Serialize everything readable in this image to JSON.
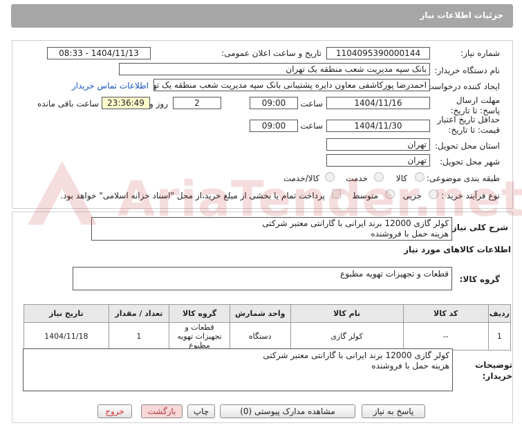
{
  "window": {
    "title": "جزئیات اطلاعات نیاز"
  },
  "form": {
    "need_number_label": "شماره نیاز:",
    "need_number": "1104095390000144",
    "announce_label": "تاریخ و ساعت اعلان عمومی:",
    "announce_value": "1404/11/13 - 08:33",
    "buyer_label": "نام دستگاه خریدار:",
    "buyer_value": "بانک سپه مدیریت شعب منطقه یک تهران",
    "requester_label": "ایجاد کننده درخواست:",
    "requester_value": "احمدرضا پورکاشفی معاون دایره پشتیبانی بانک سپه مدیریت شعب منطقه یک تهران",
    "contact_link": "اطلاعات تماس خریدار",
    "reply_deadline_label": "مهلت ارسال پاسخ: تا تاریخ:",
    "reply_date": "1404/11/16",
    "time_label": "ساعت",
    "reply_time": "09:00",
    "days_value": "2",
    "days_label": "روز و",
    "remaining_time": "23:36:49",
    "remaining_label": "ساعت باقی مانده",
    "validity_label": "حداقل تاریخ اعتبار قیمت: تا تاریخ:",
    "validity_date": "1404/11/30",
    "validity_time": "09:00",
    "province_label": "استان محل تحویل:",
    "province_value": "تهران",
    "city_label": "شهر محل تحویل:",
    "city_value": "تهران",
    "category_label": "طبقه بندی موضوعی:",
    "category_options": [
      "کالا",
      "خدمت",
      "کالا/خدمت"
    ],
    "process_label": "نوع فرآیند خرید :",
    "process_options": [
      "جزیی",
      "متوسط"
    ],
    "payment_note": "پرداخت تمام یا بخشی از مبلغ خرید،از محل \"اسناد خزانه اسلامی\" خواهد بود."
  },
  "description": {
    "label": "شرح کلی نیاز:",
    "line1": "کولر گازی 12000 برند ایرانی با گارانتی معتبر شرکتی",
    "line2": "هزینه حمل با فروشنده"
  },
  "goods": {
    "section_title": "اطلاعات کالاهای مورد نیاز",
    "group_label": "گروه کالا:",
    "group_value": "قطعات و تجهیزات تهویه مطبوع",
    "headers": [
      "ردیف",
      "کد کالا",
      "نام کالا",
      "واحد شمارش",
      "گروه کالا",
      "تعداد / مقدار",
      "تاریخ نیاز"
    ],
    "rows": [
      [
        "1",
        "--",
        "کولر گازی",
        "دستگاه",
        "قطعات و تجهیزات تهویه مطبوع",
        "1",
        "1404/11/18"
      ]
    ]
  },
  "buyer_notes": {
    "label": "توضیحات خریدار:",
    "line1": "کولر گازی 12000 برند ایرانی با گارانتی معتبر شرکتی",
    "line2": "هزینه حمل با فروشنده"
  },
  "buttons": {
    "reply": "پاسخ به نیاز",
    "attachments": "مشاهده مدارک پیوستی (0)",
    "print": "چاپ",
    "back": "بازگشت",
    "exit": "خروج"
  },
  "watermark": {
    "text": "AriaTender.net"
  },
  "colors": {
    "title_bar": "#a6a6a6",
    "link": "#1a55c4",
    "timer_bg": "#fffbcc"
  }
}
